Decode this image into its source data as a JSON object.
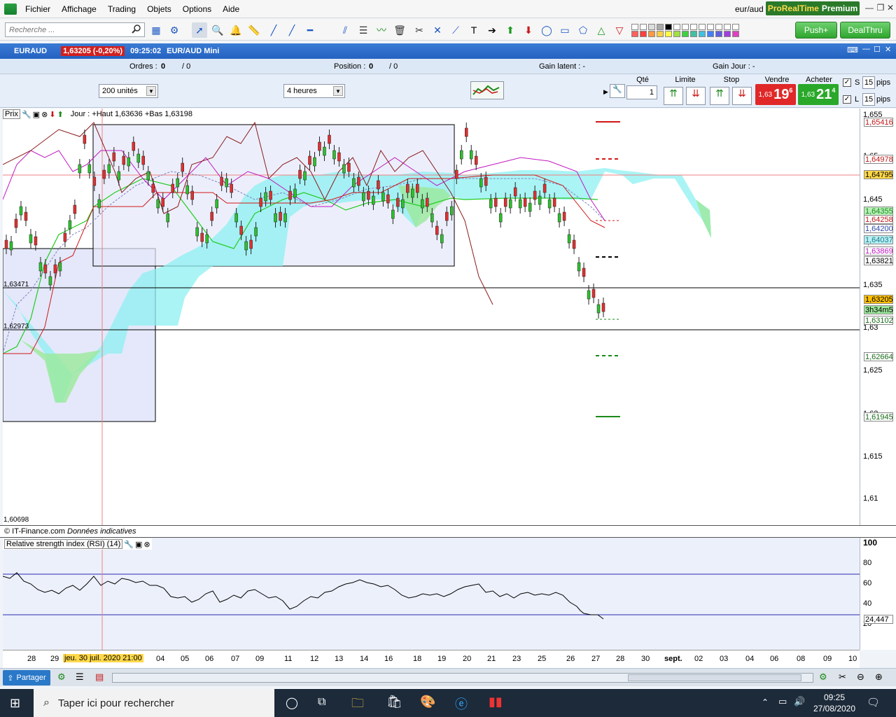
{
  "menu": {
    "items": [
      "Fichier",
      "Affichage",
      "Trading",
      "Objets",
      "Options",
      "Aide"
    ],
    "window_title": "eur/aud",
    "brand_main": "ProRealTime",
    "brand_sub": "Premium"
  },
  "toolbar": {
    "search_placeholder": "Recherche ...",
    "push_label": "Push+",
    "dealthru_label": "DealThru"
  },
  "header": {
    "symbol": "EURAUD",
    "price_badge": "1,63205 (-0,20%)",
    "time": "09:25:02",
    "title": "EUR/AUD Mini"
  },
  "orderbar": {
    "orders_label": "Ordres :",
    "orders_count": "0",
    "orders_slash": "/ 0",
    "position_label": "Position :",
    "position_count": "0",
    "position_slash": "/ 0",
    "gain_latent": "Gain latent :  -",
    "gain_jour": "Gain Jour :  -"
  },
  "config": {
    "units": "200 unités",
    "period": "4 heures",
    "qty_label": "Qté",
    "qty_value": "1",
    "limit_label": "Limite",
    "stop_label": "Stop",
    "sell_label": "Vendre",
    "buy_label": "Acheter",
    "sell_small": "1,63",
    "sell_big": "19",
    "sell_sup": "6",
    "buy_small": "1,63",
    "buy_big": "21",
    "buy_sup": "4",
    "s_label": "S",
    "l_label": "L",
    "pips_value": "15",
    "pips_label": "pips"
  },
  "chart": {
    "header_label": "Prix",
    "info": "Jour : +Haut 1,63636 +Bas 1,63198",
    "source": "© IT-Finance.com",
    "source_note": "Données indicatives",
    "left_labels": {
      "top_level": "1,63471",
      "mid_level": "1,62973",
      "bottom_level": "1,60698"
    },
    "axis_ticks": [
      "1,655",
      "1,65",
      "1,645",
      "1,64",
      "1,635",
      "1,63",
      "1,625",
      "1,62",
      "1,615",
      "1,61"
    ],
    "tags": [
      {
        "value": "1,65416",
        "color": "#c01818",
        "bg": "#ffffff"
      },
      {
        "value": "1,64978",
        "color": "#c01818",
        "bg": "#ffffff"
      },
      {
        "value": "1,64795",
        "color": "#000000",
        "bg": "#ffd84a"
      },
      {
        "value": "1,64355",
        "color": "#1a8a1a",
        "bg": "#b8f0b8"
      },
      {
        "value": "1,64258",
        "color": "#c01818",
        "bg": "#ffffff"
      },
      {
        "value": "1,64200",
        "color": "#2a48a8",
        "bg": "#ffffff"
      },
      {
        "value": "1,64037",
        "color": "#1a7a8a",
        "bg": "#b8f0f4"
      },
      {
        "value": "1,63869",
        "color": "#c018c0",
        "bg": "#ffffff"
      },
      {
        "value": "1,63821",
        "color": "#000000",
        "bg": "#ffffff"
      },
      {
        "value": "1,63205",
        "color": "#000000",
        "bg": "#ffc000"
      },
      {
        "value": "3h34m5",
        "color": "#000000",
        "bg": "#9ce89c"
      },
      {
        "value": "1,63102",
        "color": "#1a6a1a",
        "bg": "#ffffff"
      },
      {
        "value": "1,62664",
        "color": "#1a6a1a",
        "bg": "#ffffff"
      },
      {
        "value": "1,61945",
        "color": "#1a6a1a",
        "bg": "#ffffff"
      }
    ]
  },
  "rsi": {
    "title": "Relative strength index (RSI) (14)",
    "ticks": [
      "100",
      "80",
      "60",
      "40",
      "20"
    ],
    "value": "24,447"
  },
  "xaxis": {
    "labels": [
      "28",
      "29",
      "jeu. 30 juil. 2020 21:00",
      "04",
      "05",
      "06",
      "07",
      "09",
      "11",
      "12",
      "13",
      "14",
      "16",
      "18",
      "19",
      "20",
      "21",
      "23",
      "25",
      "26",
      "27",
      "28",
      "30",
      "sept.",
      "02",
      "03",
      "04",
      "06",
      "08",
      "09",
      "10"
    ]
  },
  "bottombar": {
    "share_label": "Partager"
  },
  "taskbar": {
    "search_text": "Taper ici pour rechercher",
    "time": "09:25",
    "date": "27/08/2020"
  }
}
